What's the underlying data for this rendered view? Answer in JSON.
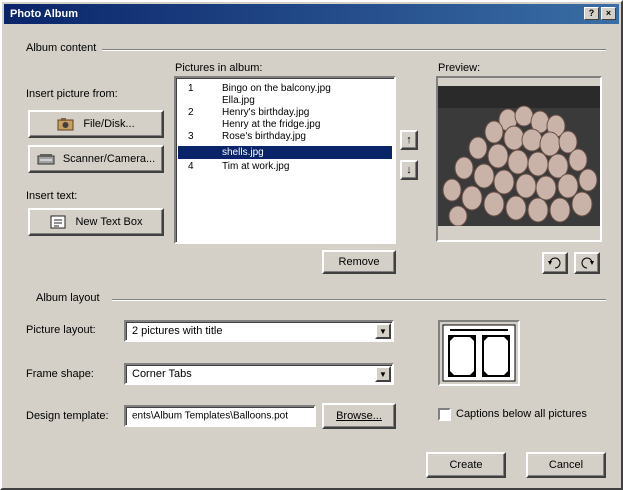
{
  "window": {
    "title": "Photo Album",
    "help_btn": "?",
    "close_btn": "×"
  },
  "album_content": {
    "group_label": "Album content",
    "insert_picture_label": "Insert picture from:",
    "file_disk_button": "File/Disk...",
    "scanner_button": "Scanner/Camera...",
    "insert_text_label": "Insert text:",
    "new_text_box_button": "New Text Box",
    "pictures_label": "Pictures in album:",
    "pictures": [
      {
        "num": "1",
        "name": "Bingo on the balcony.jpg",
        "selected": false
      },
      {
        "num": "",
        "name": "Ella.jpg",
        "selected": false
      },
      {
        "num": "2",
        "name": "Henry's birthday.jpg",
        "selected": false
      },
      {
        "num": "",
        "name": "Henry at the fridge.jpg",
        "selected": false
      },
      {
        "num": "3",
        "name": "Rose's birthday.jpg",
        "selected": false
      },
      {
        "num": "",
        "name": "shells.jpg",
        "selected": true
      },
      {
        "num": "4",
        "name": "Tim at work.jpg",
        "selected": false
      }
    ],
    "move_up": "↑",
    "move_down": "↓",
    "remove_button": "Remove",
    "preview_label": "Preview:"
  },
  "album_layout": {
    "group_label": "Album layout",
    "picture_layout_label": "Picture layout:",
    "picture_layout_value": "2 pictures with title",
    "frame_shape_label": "Frame shape:",
    "frame_shape_value": "Corner Tabs",
    "design_template_label": "Design template:",
    "design_template_value": "ents\\Album Templates\\Balloons.pot",
    "browse_button": "Browse...",
    "captions_label": "Captions below all pictures",
    "captions_checked": false
  },
  "footer": {
    "create_button": "Create",
    "cancel_button": "Cancel"
  },
  "colors": {
    "title_start": "#0a246a",
    "title_end": "#3a6ea5",
    "selection": "#0a246a",
    "face": "#d4d0c8"
  },
  "icons": {
    "file_disk": "camera-folder-icon",
    "scanner": "scanner-icon",
    "text_box": "text-box-icon",
    "rotate_left": "rotate-left-icon",
    "rotate_right": "rotate-right-icon"
  }
}
